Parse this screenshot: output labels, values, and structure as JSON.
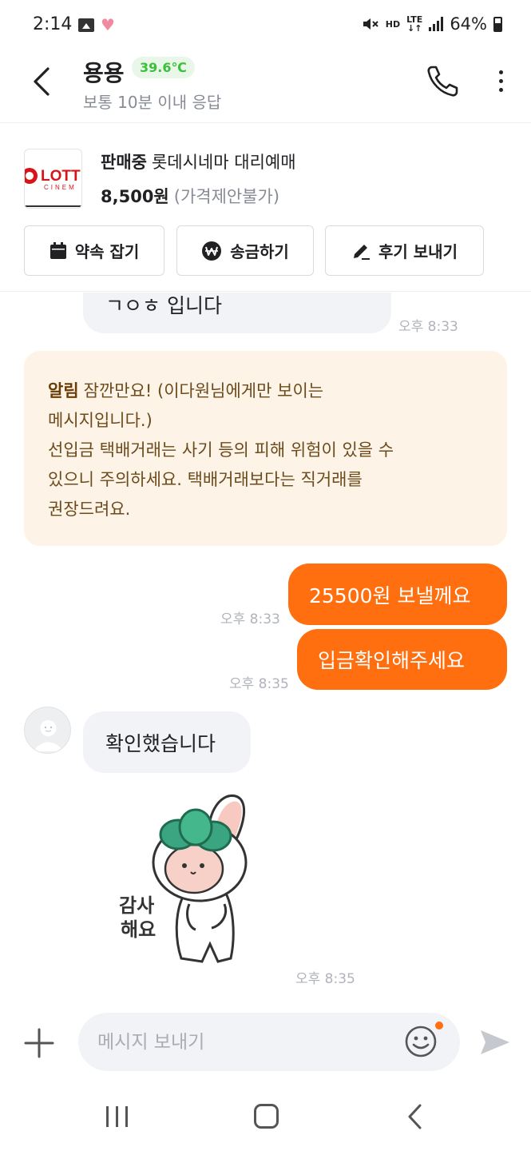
{
  "status_bar": {
    "time": "2:14",
    "network_hd": "HD",
    "network_lte": "LTE",
    "battery": "64%"
  },
  "header": {
    "nickname": "용용",
    "temperature": "39.6℃",
    "response_info": "보통 10분 이내 응답"
  },
  "product": {
    "status": "판매중",
    "title": "롯데시네마 대리예매",
    "price": "8,500원",
    "negotiation": "(가격제안불가)",
    "thumb_text_top": "LOTT",
    "thumb_text_bottom": "CINEM"
  },
  "actions": {
    "appointment": "약속 잡기",
    "transfer": "송금하기",
    "review": "후기 보내기"
  },
  "messages": {
    "partial_text": "ㄱㅇㅎ 입니다",
    "partial_time": "오후 8:33",
    "notice_title": "알림",
    "notice_line1": "잠깐만요! (이다원님에게만 보이는",
    "notice_line2": "메시지입니다.)",
    "notice_line3": "선입금 택배거래는 사기 등의 피해 위험이 있을 수",
    "notice_line4": "있으니 주의하세요. 택배거래보다는 직거래를",
    "notice_line5": "권장드려요.",
    "out1_text": "25500원 보낼께요",
    "out1_time": "오후 8:33",
    "out2_text": "입금확인해주세요",
    "out2_time": "오후 8:35",
    "in1_text": "확인했습니다",
    "sticker_text_line1": "감사",
    "sticker_text_line2": "해요",
    "sticker_time": "오후 8:35"
  },
  "input": {
    "placeholder": "메시지 보내기"
  },
  "colors": {
    "accent": "#ff6f0f",
    "temperature": "#3cc03c",
    "notice_bg": "#fdf3e6"
  }
}
